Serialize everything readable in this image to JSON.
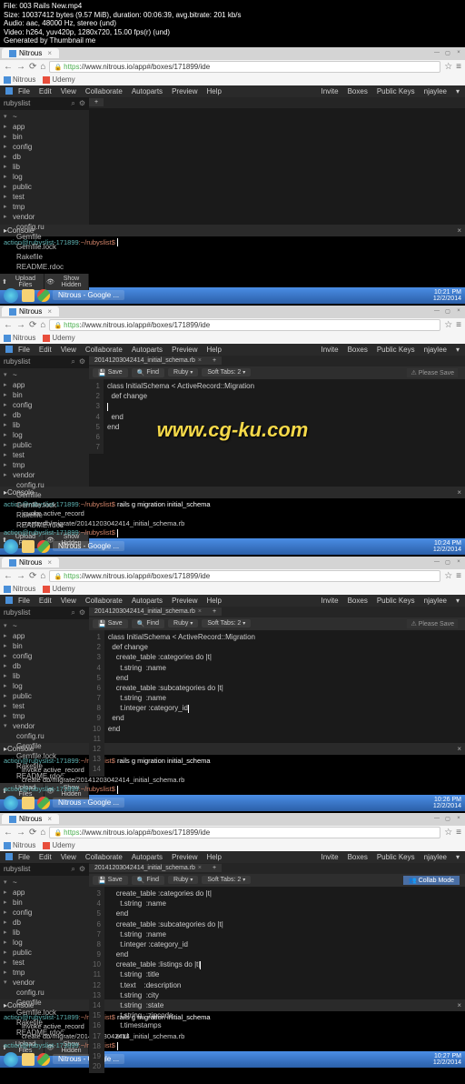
{
  "header": {
    "file": "File: 003 Rails New.mp4",
    "size": "Size: 10037412 bytes (9.57 MiB), duration: 00:06:39, avg.bitrate: 201 kb/s",
    "audio": "Audio: aac, 48000 Hz, stereo (und)",
    "video": "Video: h264, yuv420p, 1280x720, 15.00 fps(r) (und)",
    "gen": "Generated by Thumbnail me"
  },
  "browser": {
    "tab_name": "Nitrous",
    "url_prefix": "https",
    "url": "://www.nitrous.io/app#/boxes/171899/ide"
  },
  "bookmarks": {
    "nitrous": "Nitrous",
    "udemy": "Udemy"
  },
  "ide_menu": [
    "File",
    "Edit",
    "View",
    "Collaborate",
    "Autoparts",
    "Preview",
    "Help"
  ],
  "ide_right": [
    "Invite",
    "Boxes",
    "Public Keys",
    "njaylee"
  ],
  "sidebar": {
    "project": "rubyslist",
    "items": [
      "app",
      "bin",
      "config",
      "db",
      "lib",
      "log",
      "public",
      "test",
      "tmp",
      "vendor"
    ],
    "files": [
      "config.ru",
      "Gemfile",
      "Gemfile.lock",
      "Rakefile",
      "README.rdoc"
    ],
    "upload": "Upload Files",
    "hidden": "Show Hidden"
  },
  "toolbar": {
    "save": "Save",
    "find": "Find",
    "lang": "Ruby",
    "softtabs": "Soft Tabs: 2"
  },
  "hints": {
    "save": "Please Save",
    "collab": "Collab Mode"
  },
  "file_tab": "20141203042414_initial_schema.rb",
  "console_label": "Console",
  "console": {
    "prompt_user": "action@rubyslist-171899",
    "prompt_path": ":~/rubyslist$",
    "cmd_migration": "rails g migration initial_schema",
    "invoke": "invoke  active_record",
    "create": "create    db/migrate/20141203042414_initial_schema.rb"
  },
  "code_f2": {
    "l1": "class InitialSchema < ActiveRecord::Migration",
    "l2": "  def change",
    "l3": "",
    "l4": "",
    "l5": "  end",
    "l6": "end"
  },
  "code_f3": {
    "l1": "class InitialSchema < ActiveRecord::Migration",
    "l2": "  def change",
    "l3": "",
    "l4": "    create_table :categories do |t|",
    "l5": "      t.string  :name",
    "l6": "    end",
    "l7": "",
    "l8": "    create_table :subcategories do |t|",
    "l9": "      t.string  :name",
    "l10": "      t.integer :category_id",
    "l11": "",
    "l12": "",
    "l13": "  end",
    "l14": "end"
  },
  "code_f4": {
    "l1": "",
    "l2": "    create_table :categories do |t|",
    "l3": "      t.string  :name",
    "l4": "    end",
    "l5": "",
    "l6": "    create_table :subcategories do |t|",
    "l7": "      t.string  :name",
    "l8": "      t.integer :category_id",
    "l9": "    end",
    "l10": "",
    "l11": "    create_table :listings do |t|",
    "l12": "      t.string  :title",
    "l13": "      t.text    :description",
    "l14": "      t.string  :city",
    "l15": "      t.string  :state",
    "l16": "      t.string  :zipcode",
    "l17": "      t.timestamps",
    "l18": "    end"
  },
  "taskbar": {
    "item": "Nitrous - Google ...",
    "time1": "10:21 PM",
    "date1": "12/2/2014",
    "time2": "10:24 PM",
    "time3": "10:26 PM",
    "time4": "10:27 PM"
  },
  "watermark": "www.cg-ku.com"
}
